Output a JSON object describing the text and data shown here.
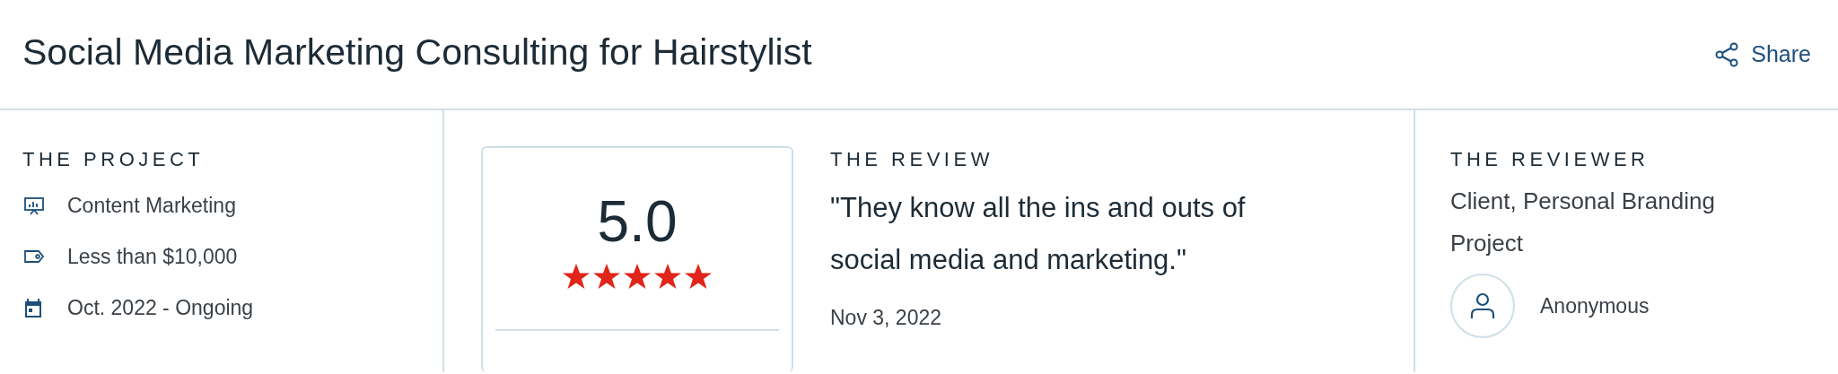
{
  "title": "Social Media Marketing Consulting for Hairstylist",
  "share": {
    "label": "Share"
  },
  "project": {
    "heading": "THE PROJECT",
    "items": [
      {
        "kind": "service",
        "text": "Content Marketing"
      },
      {
        "kind": "budget",
        "text": "Less than $10,000"
      },
      {
        "kind": "date",
        "text": "Oct. 2022 - Ongoing"
      }
    ]
  },
  "rating": {
    "score": "5.0",
    "stars": 5
  },
  "review": {
    "heading": "THE REVIEW",
    "quote": "\"They know all the ins and outs of social media and marketing.\"",
    "date": "Nov 3, 2022"
  },
  "reviewer": {
    "heading": "THE REVIEWER",
    "role": "Client, Personal Branding Project",
    "name": "Anonymous"
  }
}
